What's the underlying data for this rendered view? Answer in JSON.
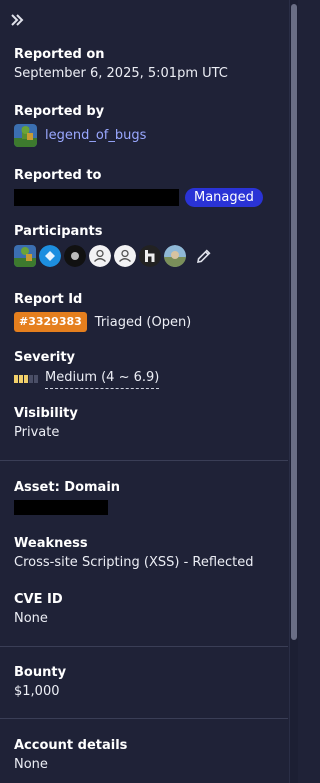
{
  "reported_on": {
    "label": "Reported on",
    "value": "September 6, 2025, 5:01pm UTC"
  },
  "reported_by": {
    "label": "Reported by",
    "username": "legend_of_bugs"
  },
  "reported_to": {
    "label": "Reported to",
    "badge": "Managed"
  },
  "participants": {
    "label": "Participants",
    "count": 7
  },
  "report_id": {
    "label": "Report Id",
    "id": "#3329383",
    "status": "Triaged (Open)"
  },
  "severity": {
    "label": "Severity",
    "value": "Medium (4 ~ 6.9)",
    "level_filled": 3,
    "level_total": 5
  },
  "visibility": {
    "label": "Visibility",
    "value": "Private"
  },
  "asset": {
    "label": "Asset: Domain"
  },
  "weakness": {
    "label": "Weakness",
    "value": "Cross-site Scripting (XSS) - Reflected"
  },
  "cve": {
    "label": "CVE ID",
    "value": "None"
  },
  "bounty": {
    "label": "Bounty",
    "value": "$1,000"
  },
  "account_details": {
    "label": "Account details",
    "value": "None"
  },
  "colors": {
    "background": "#1f2237",
    "link": "#9aa8ff",
    "managed_badge": "#2a33d6",
    "report_id_badge": "#e57f1e",
    "severity_fill": "#f2d06b"
  },
  "icons": {
    "collapse": "double-chevron-right-icon",
    "edit": "pencil-icon"
  }
}
